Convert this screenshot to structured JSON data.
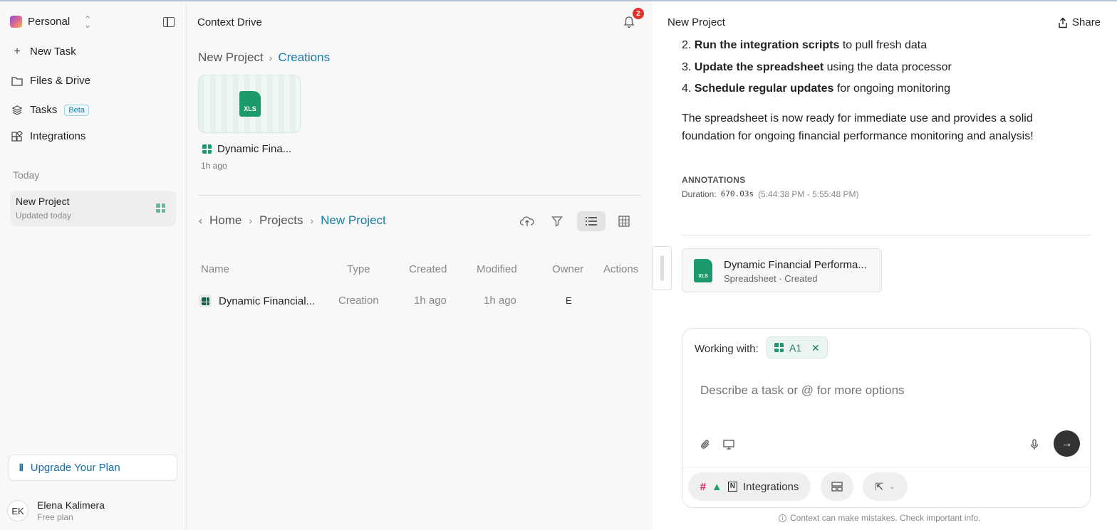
{
  "sidebar": {
    "workspace": "Personal",
    "nav": [
      {
        "label": "New Task",
        "icon": "plus-icon"
      },
      {
        "label": "Files & Drive",
        "icon": "folder-icon"
      },
      {
        "label": "Tasks",
        "icon": "layers-icon",
        "badge": "Beta"
      },
      {
        "label": "Integrations",
        "icon": "integrations-icon"
      }
    ],
    "section": "Today",
    "project": {
      "name": "New Project",
      "sub": "Updated today"
    },
    "upgrade": "Upgrade Your Plan",
    "user": {
      "initials": "EK",
      "name": "Elena Kalimera",
      "plan": "Free plan"
    }
  },
  "drive": {
    "title": "Context Drive",
    "notifications": "2",
    "crumb_top": [
      "New Project",
      "Creations"
    ],
    "thumb": {
      "ext": "XLS",
      "name": "Dynamic Fina...",
      "time": "1h ago"
    },
    "crumb": [
      "Home",
      "Projects",
      "New Project"
    ],
    "columns": [
      "Name",
      "Type",
      "Created",
      "Modified",
      "Owner",
      "Actions"
    ],
    "row": {
      "name": "Dynamic Financial...",
      "type": "Creation",
      "created": "1h ago",
      "modified": "1h ago",
      "owner": "E"
    }
  },
  "chat": {
    "title": "New Project",
    "share": "Share",
    "steps": [
      {
        "n": "2.",
        "bold": "Run the integration scripts",
        "rest": " to pull fresh data"
      },
      {
        "n": "3.",
        "bold": "Update the spreadsheet",
        "rest": " using the data processor"
      },
      {
        "n": "4.",
        "bold": "Schedule regular updates",
        "rest": " for ongoing monitoring"
      }
    ],
    "summary": "The spreadsheet is now ready for immediate use and provides a solid foundation for ongoing financial performance monitoring and analysis!",
    "annotations_label": "ANNOTATIONS",
    "duration_label": "Duration:",
    "duration_value": "670.03s",
    "duration_range": "(5:44:38 PM - 5:55:48 PM)",
    "file": {
      "ext": "XLS",
      "name": "Dynamic Financial Performa...",
      "sub": "Spreadsheet · Created"
    },
    "composer": {
      "working_with": "Working with:",
      "chip": "A1",
      "placeholder": "Describe a task or @ for more options",
      "integrations": "Integrations"
    },
    "disclaimer": "Context can make mistakes. Check important info."
  }
}
